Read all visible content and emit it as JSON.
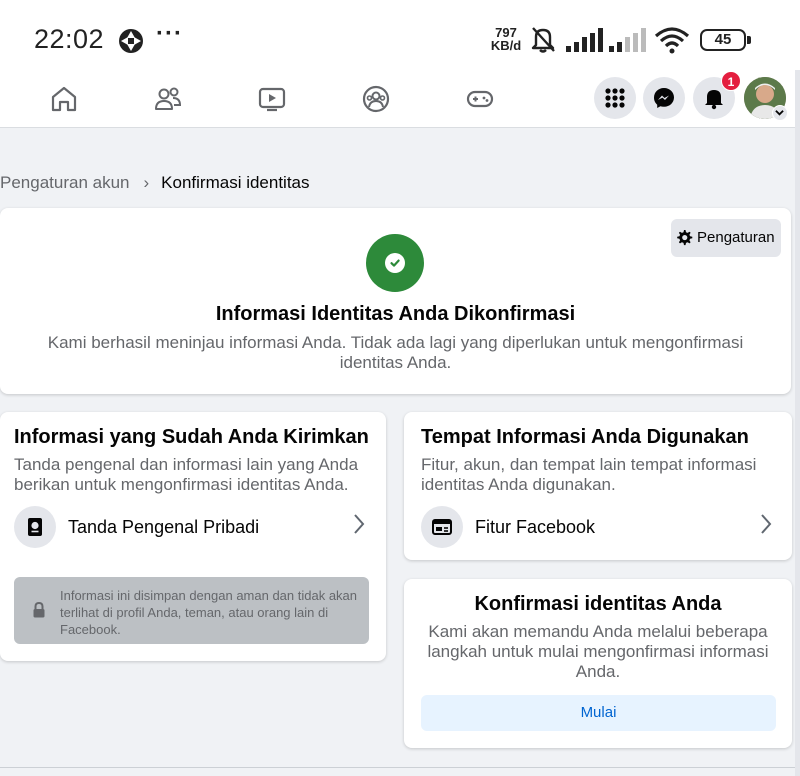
{
  "status_bar": {
    "time": "22:02",
    "net_speed_value": "797",
    "net_speed_unit": "KB/d",
    "battery": "45",
    "icons": [
      "aperture-icon",
      "more-dots-icon",
      "bell-muted-icon",
      "signal-icon",
      "signal-weak-icon",
      "wifi-icon",
      "battery-icon"
    ]
  },
  "nav": {
    "tabs": [
      "home-icon",
      "friends-icon",
      "video-icon",
      "groups-icon",
      "gaming-icon"
    ],
    "actions": [
      "menu-grid-icon",
      "messenger-icon",
      "notifications-icon"
    ],
    "notification_count": "1",
    "accent": "#1877f2"
  },
  "breadcrumb": {
    "parent": "Pengaturan akun",
    "separator": "›",
    "current": "Konfirmasi identitas"
  },
  "hero": {
    "settings_label": "Pengaturan",
    "title": "Informasi Identitas Anda Dikonfirmasi",
    "description": "Kami berhasil meninjau informasi Anda. Tidak ada lagi yang diperlukan untuk mengonfirmasi identitas Anda.",
    "status_color": "#2d8a3a"
  },
  "submitted": {
    "title": "Informasi yang Sudah Anda Kirimkan",
    "description": "Tanda pengenal dan informasi lain yang Anda berikan untuk mengonfirmasi identitas Anda.",
    "item_label": "Tanda Pengenal Pribadi",
    "privacy_note": "Informasi ini disimpan dengan aman dan tidak akan terlihat di profil Anda, teman, atau orang lain di Facebook."
  },
  "usage": {
    "title": "Tempat Informasi Anda Digunakan",
    "description": "Fitur, akun, dan tempat lain tempat informasi identitas Anda digunakan.",
    "item_label": "Fitur Facebook"
  },
  "confirm": {
    "title": "Konfirmasi identitas Anda",
    "description": "Kami akan memandu Anda melalui beberapa langkah untuk mulai mengonfirmasi informasi Anda.",
    "button_label": "Mulai"
  }
}
